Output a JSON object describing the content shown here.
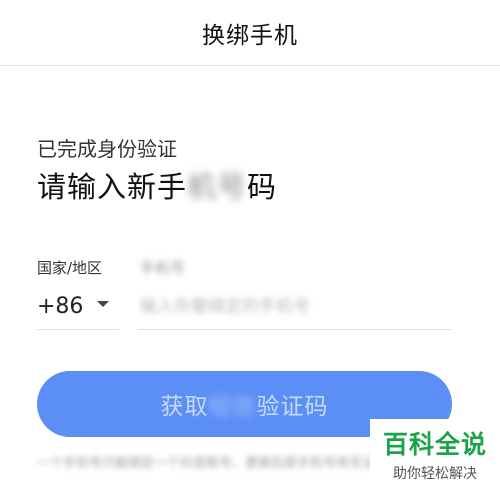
{
  "header": {
    "title": "换绑手机"
  },
  "verify": {
    "subtitle": "已完成身份验证",
    "heading_prefix": "请输入新手",
    "heading_obscured": "机号",
    "heading_suffix": "码"
  },
  "form": {
    "country_label": "国家/地区",
    "phone_label": "手机号",
    "country_code": "+86",
    "phone_value": "",
    "phone_placeholder": "输入你要绑定的手机号"
  },
  "button": {
    "label_prefix": "获取",
    "label_obscured": "短信",
    "label_suffix": "验证码"
  },
  "footnote": {
    "text": "一个手机号只能绑定一个抖音账号，更换后原手机号将无法登录"
  },
  "watermark": {
    "main": "百科全说",
    "sub": "助你轻松解决"
  },
  "icons": {
    "country_dropdown": "chevron-down-icon"
  }
}
